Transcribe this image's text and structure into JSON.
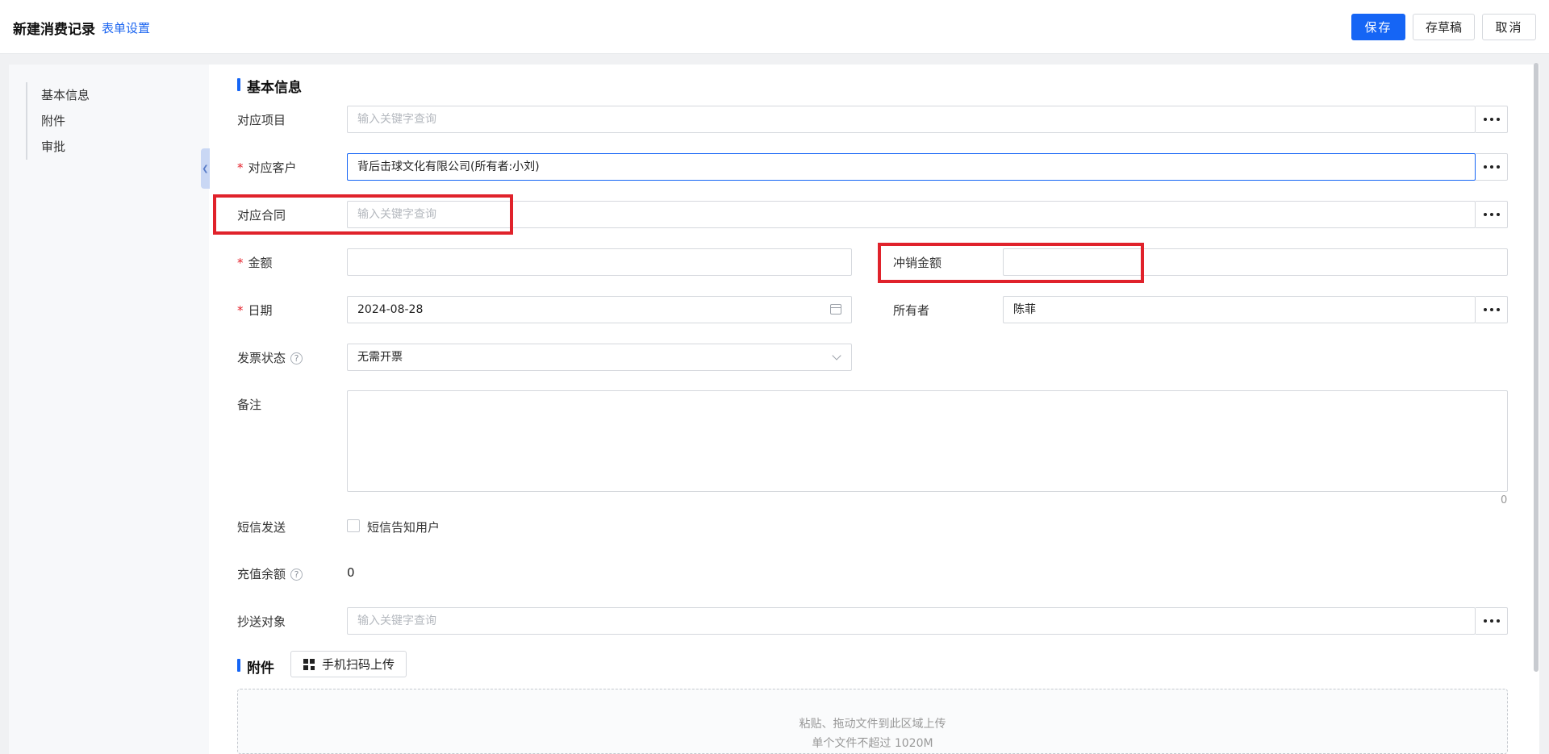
{
  "header": {
    "title": "新建消费记录",
    "form_settings": "表单设置",
    "save": "保存",
    "draft": "存草稿",
    "cancel": "取消"
  },
  "nav": {
    "items": [
      "基本信息",
      "附件",
      "审批"
    ]
  },
  "basic_info": {
    "section_title": "基本信息",
    "project": {
      "label": "对应项目",
      "placeholder": "输入关键字查询"
    },
    "customer": {
      "label": "对应客户",
      "value": "背后击球文化有限公司(所有者:小刘)"
    },
    "contract": {
      "label": "对应合同",
      "placeholder": "输入关键字查询"
    },
    "amount": {
      "label": "金额",
      "value": ""
    },
    "offset_amount": {
      "label": "冲销金额",
      "value": ""
    },
    "date": {
      "label": "日期",
      "value": "2024-08-28"
    },
    "owner": {
      "label": "所有者",
      "value": "陈菲"
    },
    "invoice_status": {
      "label": "发票状态",
      "value": "无需开票"
    },
    "remark": {
      "label": "备注",
      "counter": "0"
    },
    "sms": {
      "label": "短信发送",
      "option": "短信告知用户"
    },
    "balance": {
      "label": "充值余额",
      "value": "0"
    },
    "cc": {
      "label": "抄送对象",
      "placeholder": "输入关键字查询"
    }
  },
  "attachments": {
    "section_title": "附件",
    "scan_upload": "手机扫码上传",
    "drop_hint": "粘贴、拖动文件到此区域上传",
    "size_hint": "单个文件不超过 1020M"
  },
  "colors": {
    "primary": "#1565f5",
    "required": "#e5202a",
    "highlight": "#e0222b"
  }
}
